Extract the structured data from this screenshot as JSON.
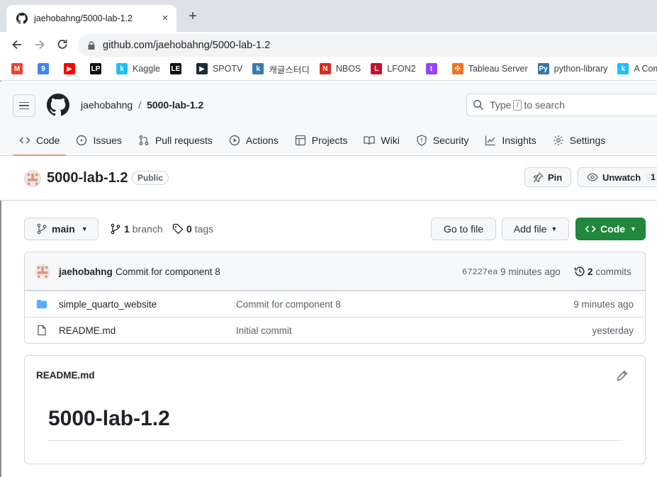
{
  "browser": {
    "tab_title": "jaehobahng/5000-lab-1.2",
    "close": "×",
    "new_tab": "+",
    "url": "github.com/jaehobahng/5000-lab-1.2",
    "bookmarks": [
      {
        "label": "",
        "icon": "gmail-icon",
        "color": "#ea4335",
        "glyph": "M"
      },
      {
        "label": "",
        "icon": "calendar-icon",
        "color": "#4285f4",
        "glyph": "9"
      },
      {
        "label": "",
        "icon": "youtube-icon",
        "color": "#ff0000",
        "glyph": "▶"
      },
      {
        "label": "",
        "icon": "lp-icon",
        "color": "#111111",
        "glyph": "LP"
      },
      {
        "label": "Kaggle",
        "icon": "kaggle-icon",
        "color": "#20beff",
        "glyph": "k"
      },
      {
        "label": "",
        "icon": "le-icon",
        "color": "#111111",
        "glyph": "LE"
      },
      {
        "label": "SPOTV",
        "icon": "spotv-icon",
        "color": "#1e2a3a",
        "glyph": "▶"
      },
      {
        "label": "캐글스터디",
        "icon": "kaggle-study-icon",
        "color": "#3a7ca5",
        "glyph": "k"
      },
      {
        "label": "NBOS",
        "icon": "nbos-icon",
        "color": "#d62d20",
        "glyph": "N"
      },
      {
        "label": "LFON2",
        "icon": "lfon2-icon",
        "color": "#c8102e",
        "glyph": "L"
      },
      {
        "label": "",
        "icon": "twitch-icon",
        "color": "#9146ff",
        "glyph": "t"
      },
      {
        "label": "Tableau Server",
        "icon": "tableau-icon",
        "color": "#e97627",
        "glyph": "✣"
      },
      {
        "label": "python-library",
        "icon": "python-icon",
        "color": "#3776ab",
        "glyph": "Py"
      },
      {
        "label": "A Comple",
        "icon": "kaggle-icon-2",
        "color": "#20beff",
        "glyph": "k"
      }
    ]
  },
  "header": {
    "owner": "jaehobahng",
    "separator": "/",
    "repo": "5000-lab-1.2",
    "search_prefix": "Type",
    "search_key": "/",
    "search_suffix": "to search"
  },
  "repo_nav": [
    {
      "label": "Code",
      "icon": "code-icon",
      "active": true
    },
    {
      "label": "Issues",
      "icon": "issue-icon"
    },
    {
      "label": "Pull requests",
      "icon": "pull-request-icon"
    },
    {
      "label": "Actions",
      "icon": "actions-icon"
    },
    {
      "label": "Projects",
      "icon": "projects-icon"
    },
    {
      "label": "Wiki",
      "icon": "wiki-icon"
    },
    {
      "label": "Security",
      "icon": "shield-icon"
    },
    {
      "label": "Insights",
      "icon": "graph-icon"
    },
    {
      "label": "Settings",
      "icon": "gear-icon"
    }
  ],
  "repo": {
    "name": "5000-lab-1.2",
    "visibility": "Public",
    "pin_label": "Pin",
    "watch_label": "Unwatch",
    "watch_count": "1"
  },
  "branch_bar": {
    "branch": "main",
    "branch_count": "1",
    "branch_label": "branch",
    "tag_count": "0",
    "tag_label": "tags",
    "go_to_file": "Go to file",
    "add_file": "Add file",
    "code": "Code"
  },
  "latest_commit": {
    "author": "jaehobahng",
    "message": "Commit for component 8",
    "sha": "67227ea",
    "time": "9 minutes ago",
    "commit_count": "2",
    "commit_label": "commits"
  },
  "files": [
    {
      "name": "simple_quarto_website",
      "type": "folder",
      "message": "Commit for component 8",
      "time": "9 minutes ago"
    },
    {
      "name": "README.md",
      "type": "file",
      "message": "Initial commit",
      "time": "yesterday"
    }
  ],
  "readme": {
    "filename": "README.md",
    "heading": "5000-lab-1.2"
  },
  "colors": {
    "accent_green": "#1f883d",
    "nav_underline": "#fd8c73",
    "folder_blue": "#54aeff"
  }
}
